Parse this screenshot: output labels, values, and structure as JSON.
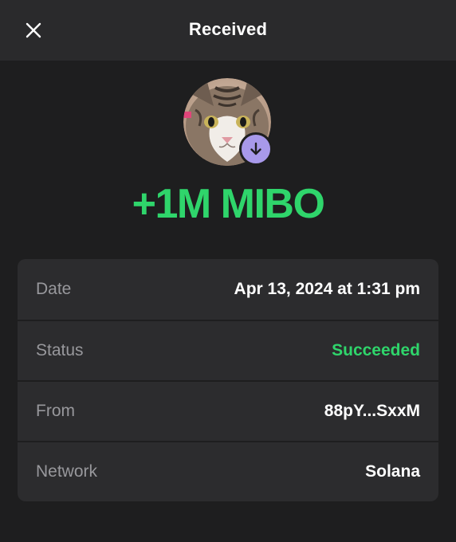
{
  "header": {
    "title": "Received",
    "close_icon": "close-icon"
  },
  "transaction": {
    "amount": "+1M MIBO",
    "amount_color": "#2fd56b",
    "direction_icon": "arrow-down-icon",
    "badge_color": "#a899ea"
  },
  "details": [
    {
      "label": "Date",
      "value": "Apr 13, 2024 at 1:31 pm"
    },
    {
      "label": "Status",
      "value": "Succeeded",
      "value_color": "#2fd56b"
    },
    {
      "label": "From",
      "value": "88pY...SxxM"
    },
    {
      "label": "Network",
      "value": "Solana"
    }
  ]
}
